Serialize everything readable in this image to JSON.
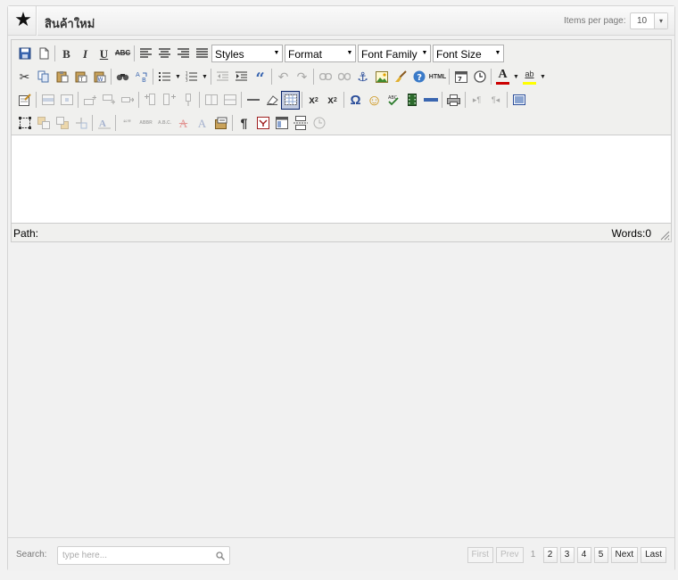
{
  "header": {
    "title": "สินค้าใหม่",
    "items_per_page_label": "Items per page:",
    "items_per_page_value": "10",
    "dropdown_arrow": "▾"
  },
  "toolbar": {
    "row1": {
      "icons": [
        "save-icon",
        "new-document-icon",
        "bold-icon",
        "italic-icon",
        "underline-icon",
        "strikethrough-icon",
        "align-left-icon",
        "align-center-icon",
        "align-right-icon",
        "align-justify-icon"
      ],
      "glyphs": {
        "bold": "B",
        "italic": "I",
        "underline": "U",
        "strikethrough": "ABC"
      },
      "styles": "Styles",
      "format": "Format",
      "font_family": "Font Family",
      "font_size": "Font Size"
    },
    "row2": {
      "icons": [
        "cut-icon",
        "copy-icon",
        "paste-icon",
        "paste-text-icon",
        "paste-word-icon",
        "find-icon",
        "replace-icon",
        "bullet-list-icon",
        "numbered-list-icon",
        "outdent-icon",
        "indent-icon",
        "blockquote-icon",
        "undo-icon",
        "redo-icon",
        "link-icon",
        "unlink-icon",
        "anchor-icon",
        "image-icon",
        "cleanup-icon",
        "help-icon",
        "html-icon",
        "insert-date-icon",
        "insert-time-icon",
        "text-color-icon",
        "highlight-color-icon"
      ],
      "html_label": "HTML",
      "quote_glyph": "“",
      "text_color_glyph": "A",
      "highlight_glyph": "ab"
    },
    "row3": {
      "icons": [
        "edit-table-icon",
        "row-props-icon",
        "cell-props-icon",
        "insert-row-before-icon",
        "insert-row-after-icon",
        "delete-row-icon",
        "insert-col-before-icon",
        "insert-col-after-icon",
        "delete-col-icon",
        "split-cells-icon",
        "merge-cells-icon",
        "horizontal-rule-icon",
        "remove-format-icon",
        "visual-aid-icon",
        "subscript-icon",
        "superscript-icon",
        "special-char-icon",
        "emoticon-icon",
        "spellcheck-icon",
        "media-icon",
        "advanced-hr-icon",
        "print-icon",
        "ltr-icon",
        "rtl-icon",
        "fullscreen-icon"
      ],
      "sub_glyph": "x",
      "sub_index": "2",
      "sup_glyph": "x",
      "sup_index": "2",
      "omega_glyph": "Ω",
      "smiley_glyph": "☺"
    },
    "row4": {
      "icons": [
        "insert-layer-icon",
        "move-forward-icon",
        "move-backward-icon",
        "absolute-icon",
        "styleprops-icon",
        "cite-icon",
        "abbr-icon",
        "acronym-icon",
        "del-icon",
        "ins-icon",
        "attribs-icon",
        "show-blocks-icon",
        "nonbreaking-icon",
        "template-icon",
        "page-break-icon",
        "restore-draft-icon"
      ],
      "pilcrow_glyph": "¶",
      "cite_glyph": "“”",
      "abbr_glyph": "ABBR",
      "acronym_glyph": "A.B.C.",
      "ins_glyph": "A"
    }
  },
  "editor": {
    "path_label": "Path:",
    "words_label": "Words:0"
  },
  "footer": {
    "search_label": "Search:",
    "search_placeholder": "type here...",
    "pager": {
      "first": "First",
      "prev": "Prev",
      "pages": [
        "1",
        "2",
        "3",
        "4",
        "5"
      ],
      "next": "Next",
      "last": "Last"
    }
  },
  "colors": {
    "panel_bg": "#f1f1f1",
    "editor_toolbar_bg": "#f0f0ee",
    "text_color_bar": "#cc0000",
    "highlight_color_bar": "#ffff00"
  }
}
